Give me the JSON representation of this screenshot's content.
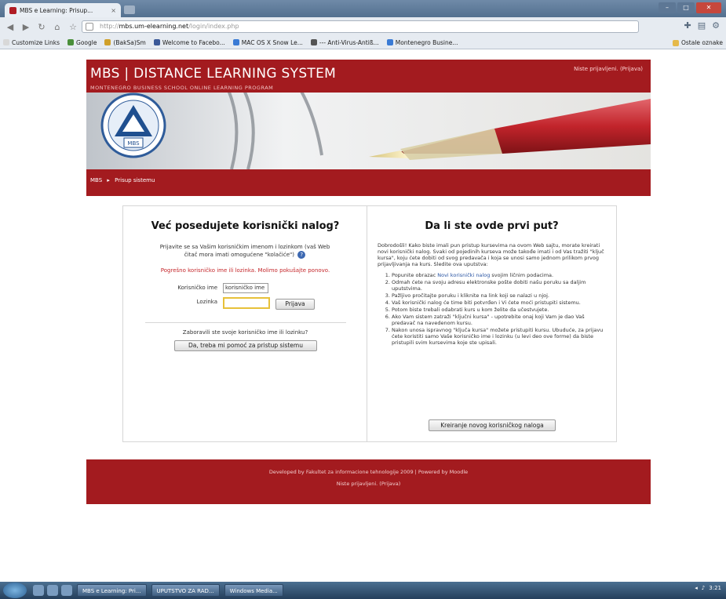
{
  "browser": {
    "tab_title": "MBS e Learning: Prisup...",
    "tab_close": "×",
    "address": {
      "host": "mbs.um-elearning.net",
      "path": "/login/index.php",
      "scheme": "http://"
    },
    "nav_icons": [
      "back-icon",
      "forward-icon",
      "reload-icon",
      "home-icon",
      "star-icon"
    ],
    "bookmarks": [
      "Customize Links",
      "Google",
      "(BakSa)Sm",
      "Welcome to Facebo...",
      "MAC OS X Snow Le...",
      "--- Anti-Virus-Antiß...",
      "Montenegro Busine..."
    ],
    "bookmark_colors": [
      "#d8d8d8",
      "#4a8f3a",
      "#d0a02a",
      "#3b5998",
      "#3a7bd5",
      "#555555",
      "#3a7bd5"
    ],
    "bookmarks_right": "Ostale oznake",
    "toolbar_icons": [
      "pin-icon",
      "page-icon",
      "wrench-icon"
    ]
  },
  "site": {
    "title": "MBS | DISTANCE LEARNING SYSTEM",
    "subtitle": "MONTENEGRO BUSINESS SCHOOL ONLINE LEARNING PROGRAM",
    "login_status": "Niste prijavljeni. (Prijava)",
    "logo_text": "MBS",
    "breadcrumb": [
      "MBS",
      "▸",
      "Prisup sistemu"
    ],
    "accent_color": "#a31b1f"
  },
  "login": {
    "heading": "Već posedujete korisnički nalog?",
    "intro": "Prijavite se sa Vašim korisničkim imenom i lozinkom (vaš Web čitač mora imati omogućene \"kolačiće\")",
    "warning": "Pogrešno korisničko ime ili lozinka. Molimo pokušajte ponovo.",
    "username_label": "Korisničko ime",
    "username_value": "korisničko ime",
    "password_label": "Lozinka",
    "password_value": "",
    "login_button": "Prijava",
    "forgot_question": "Zaboravili ste svoje korisničko ime ili lozinku?",
    "forgot_button": "Da, treba mi pomoć za pristup sistemu"
  },
  "signup": {
    "heading": "Da li ste ovde prvi put?",
    "paragraph": "Dobrodošli! Kako biste imali pun pristup kursevima na ovom Web sajtu, morate kreirati novi korisnički nalog. Svaki od pojedinih kurseva može takođe imati i od Vas tražiti \"ključ kursa\", koju ćete dobiti od svog predavača i koja se unosi samo jednom prilikom prvog prijavljivanja na kurs. Sledite ova uputstva:",
    "steps": [
      {
        "pre": "Popunite obrazac ",
        "link": "Novi korisnički nalog",
        "post": " svojim ličnim podacima."
      },
      {
        "pre": "Odmah ćete na svoju adresu elektronske pošte dobiti našu poruku sa daljim uputstvima.",
        "link": "",
        "post": ""
      },
      {
        "pre": "Pažljivo pročitajte poruku i kliknite na link koji se nalazi u njoj.",
        "link": "",
        "post": ""
      },
      {
        "pre": "Vaš korisnički nalog će time biti potvrđen i Vi ćete moći pristupiti sistemu.",
        "link": "",
        "post": ""
      },
      {
        "pre": "Potom biste trebali odabrati kurs u kom želite da učestvujete.",
        "link": "",
        "post": ""
      },
      {
        "pre": "Ako Vam sistem zatraži \"ključni kursa\" - upotrebite onaj koji Vam je dao Vaš predavač na navedenom kursu.",
        "link": "",
        "post": ""
      },
      {
        "pre": "Nakon unosa ispravnog \"ključa kursa\" možete pristupiti kursu. Ubuduće, za prijavu ćete koristiti samo Vaše korisničko ime i lozinku (u levi deo ove forme) da biste pristupili svim kursevima koje ste upisali.",
        "link": "",
        "post": ""
      }
    ],
    "create_button": "Kreiranje novog korisničkog naloga"
  },
  "footer": {
    "line1": "Developed by Fakultet za informacione tehnologije 2009 | Powered by Moodle",
    "line2": "Niste prijavljeni. (Prijava)"
  },
  "taskbar": {
    "buttons": [
      "MBS e Learning: Pri...",
      "UPUTSTVO ZA RAD...",
      "Windows Media..."
    ],
    "time": "3:21"
  }
}
